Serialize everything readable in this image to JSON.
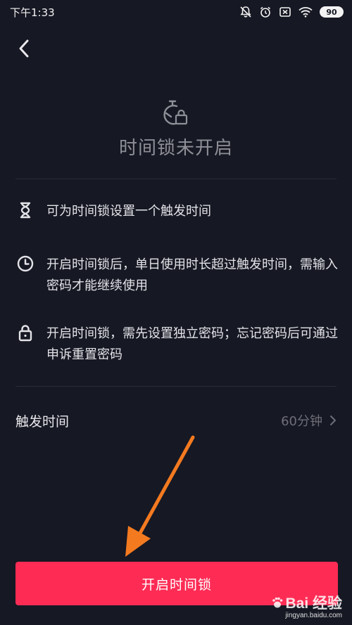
{
  "status_bar": {
    "time": "下午1:33",
    "battery": "90"
  },
  "header": {
    "title": "时间锁未开启"
  },
  "features": [
    {
      "icon": "hourglass-icon",
      "text": "可为时间锁设置一个触发时间"
    },
    {
      "icon": "clock-icon",
      "text": "开启时间锁后，单日使用时长超过触发时间，需输入密码才能继续使用"
    },
    {
      "icon": "lock-icon",
      "text": "开启时间锁，需先设置独立密码；忘记密码后可通过申诉重置密码"
    }
  ],
  "trigger": {
    "label": "触发时间",
    "value": "60分钟"
  },
  "cta": {
    "label": "开启时间锁"
  },
  "watermark": {
    "brand": "Bai  经验",
    "url": "jingyan.baidu.com"
  },
  "colors": {
    "background": "#161823",
    "accent": "#fe2c55",
    "annotation_arrow": "#f47a20"
  }
}
